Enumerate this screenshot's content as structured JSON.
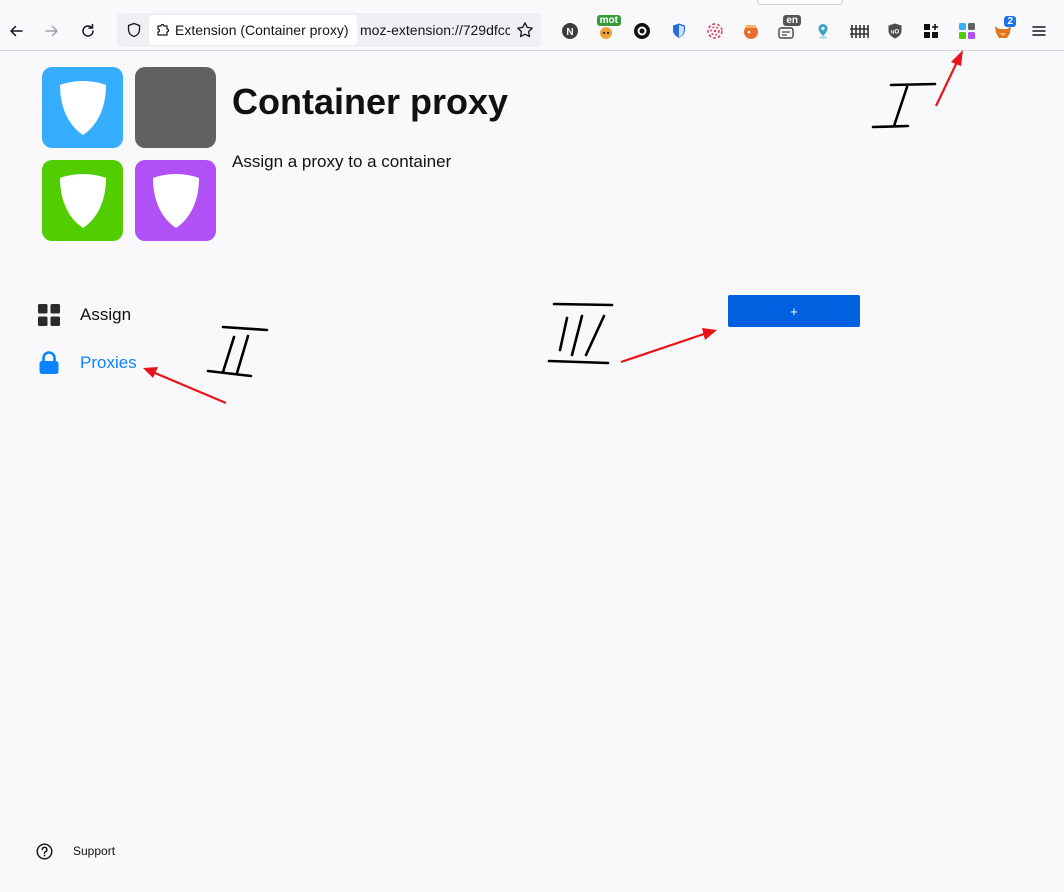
{
  "browser": {
    "identity_label": "Extension (Container proxy)",
    "url": "moz-extension://729dfcc",
    "extensions": [
      {
        "name": "n-icon",
        "glyph": "N",
        "badge": ""
      },
      {
        "name": "mot-icon",
        "glyph": "",
        "badge": "mot"
      },
      {
        "name": "face-icon",
        "glyph": "",
        "badge": ""
      },
      {
        "name": "shield-check-icon",
        "glyph": "",
        "badge": ""
      },
      {
        "name": "fingerprint-icon",
        "glyph": "",
        "badge": ""
      },
      {
        "name": "fishbowl-icon",
        "glyph": "",
        "badge": ""
      },
      {
        "name": "translate-icon",
        "glyph": "",
        "badge": "en"
      },
      {
        "name": "location-pin-icon",
        "glyph": "",
        "badge": ""
      },
      {
        "name": "fence-icon",
        "glyph": "",
        "badge": ""
      },
      {
        "name": "ublock-icon",
        "glyph": "",
        "badge": ""
      },
      {
        "name": "grid-add-icon",
        "glyph": "",
        "badge": ""
      },
      {
        "name": "container-proxy-icon",
        "glyph": "",
        "badge": ""
      },
      {
        "name": "fox-icon",
        "glyph": "",
        "badge": "2"
      }
    ]
  },
  "header": {
    "title": "Container proxy",
    "subtitle": "Assign a proxy to a container"
  },
  "sidebar": {
    "items": [
      {
        "label": "Assign",
        "icon": "grid-icon",
        "active": false
      },
      {
        "label": "Proxies",
        "icon": "lock-icon",
        "active": true
      }
    ]
  },
  "main": {
    "add_button_label": "+"
  },
  "footer": {
    "support_label": "Support"
  },
  "annotations": {
    "marks": [
      "I",
      "II",
      "III"
    ]
  },
  "colors": {
    "accent": "#0060df",
    "active_link": "#0a84ff",
    "tile_blue": "#37adff",
    "tile_gray": "#616161",
    "tile_green": "#51cd00",
    "tile_purple": "#af51f5",
    "annotation_arrow": "#e8141a"
  }
}
